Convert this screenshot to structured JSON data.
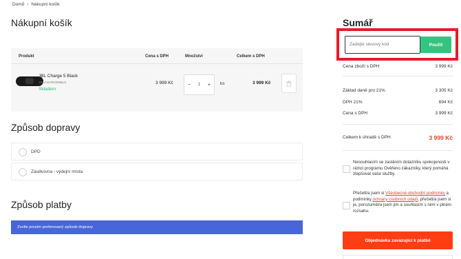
{
  "breadcrumb": {
    "home": "Domů",
    "separator": "›",
    "current": "Nákupní košík"
  },
  "cart": {
    "title": "Nákupní košík",
    "columns": {
      "product": "Produkt",
      "price": "Cena s DPH",
      "quantity": "Množství",
      "total": "Celkem s DPH"
    },
    "items": [
      {
        "name": "JBL Charge 5 Black",
        "code": "JBLCHARGE5BLK",
        "stock": "Skladem",
        "price": "3 999 Kč",
        "quantity": "1",
        "unit": "ks",
        "total": "3 999 Kč",
        "minus": "−",
        "plus": "+"
      }
    ]
  },
  "shipping": {
    "title": "Způsob dopravy",
    "options": [
      {
        "label": "DPD"
      },
      {
        "label": "Zásilkovna - výdejní místa"
      }
    ]
  },
  "payment": {
    "title": "Způsob platby",
    "placeholder_text": "Zvolte prosím preferovaný způsob dopravy"
  },
  "summary": {
    "title": "Sumář",
    "coupon": {
      "placeholder": "Zadejte slevový kód",
      "button": "Použít"
    },
    "lines": [
      {
        "label": "Cena zboží s DPH",
        "value": "3 999 Kč"
      },
      {
        "label": "Základ daně pro 21%",
        "value": "3 305 Kč"
      },
      {
        "label": "DPH 21%",
        "value": "694 Kč"
      },
      {
        "label": "Cena s DPH",
        "value": "3 999 Kč"
      }
    ],
    "grand_total": {
      "label": "Celkem k úhradě s DPH",
      "value": "3 999 Kč"
    },
    "consents": {
      "newsletter": "Nesouhlasím se zasláním dotazníku spokojenosti v rámci programu Ověřeno zákazníky, který pomáhá zlepšovat vaše služby.",
      "terms_prefix": "Přečetl/a jsem si ",
      "terms_link": "Všeobecné obchodní podmínky",
      "terms_middle": " a podmínky ",
      "privacy_link": "ochrany osobních údajů",
      "terms_suffix": ", přečetl/a jsem si je, porozuměl/a jsem jim a souhlasím s nimi v plném rozsahu."
    },
    "order_button": "Objednávka zavazující k platbě"
  },
  "colors": {
    "accent_green": "#35c47f",
    "order_orange": "#ff3d12",
    "payment_blue": "#4866d9",
    "highlight_red": "#e7192a",
    "price_red": "#e8402a"
  }
}
